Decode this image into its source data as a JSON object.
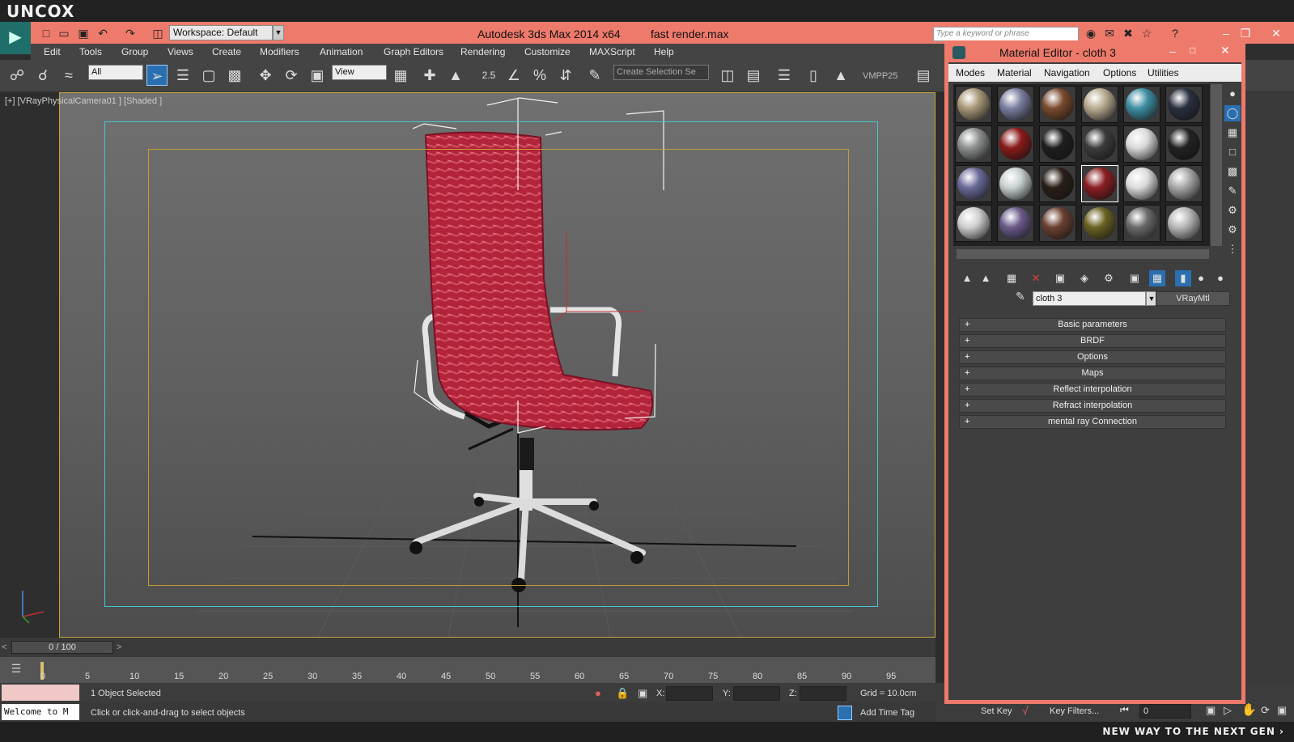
{
  "brand": {
    "logo": "UNCOX",
    "tagline": "NEW WAY TO THE NEXT GEN ›"
  },
  "titlebar": {
    "workspace": "Workspace: Default",
    "app_title": "Autodesk 3ds Max  2014 x64",
    "file_name": "fast render.max",
    "search_placeholder": "Type a keyword or phrase"
  },
  "menus": [
    "Edit",
    "Tools",
    "Group",
    "Views",
    "Create",
    "Modifiers",
    "Animation",
    "Graph Editors",
    "Rendering",
    "Customize",
    "MAXScript",
    "Help"
  ],
  "toolbar": {
    "filter": "All",
    "ref_coord": "View",
    "snap_value": "2.5",
    "selection_set": "Create Selection Se",
    "plugin_label": "VMPP25"
  },
  "viewport": {
    "label": "[+] [VRayPhysicalCamera01 ] [Shaded ]"
  },
  "timeline": {
    "frame": "0 / 100",
    "ticks": [
      "0",
      "5",
      "10",
      "15",
      "20",
      "25",
      "30",
      "35",
      "40",
      "45",
      "50",
      "55",
      "60",
      "65",
      "70",
      "75",
      "80",
      "85",
      "90",
      "95"
    ]
  },
  "status": {
    "selection": "1 Object Selected",
    "prompt": "Click or click-and-drag to select objects",
    "welcome": "Welcome to M",
    "x_label": "X:",
    "y_label": "Y:",
    "z_label": "Z:",
    "grid": "Grid = 10.0cm",
    "add_time_tag": "Add Time Tag",
    "set_key": "Set Key",
    "key_filters": "Key Filters...",
    "frame_value": "0"
  },
  "material_editor": {
    "title": "Material Editor - cloth 3",
    "menus": [
      "Modes",
      "Material",
      "Navigation",
      "Options",
      "Utilities"
    ],
    "material_name": "cloth 3",
    "material_type": "VRayMtl",
    "rollouts": [
      "Basic parameters",
      "BRDF",
      "Options",
      "Maps",
      "Reflect interpolation",
      "Refract interpolation",
      "mental ray Connection"
    ],
    "spheres": [
      "#a89878",
      "#7a7fa0",
      "#7a4a2e",
      "#b8ab90",
      "#3d8ea3",
      "#2a3040",
      "#8e9090",
      "#8a1a1a",
      "#1e1e1e",
      "#3c3c3c",
      "#dadada",
      "#222222",
      "#6a6a9a",
      "#c8d0d0",
      "#2a1e18",
      "#8a1e22",
      "#dcdcdc",
      "#a8a8a8",
      "#cfcfcf",
      "#6a5a8a",
      "#6a4030",
      "#6a6222",
      "#6a6a6a",
      "#b8b8b8"
    ]
  }
}
